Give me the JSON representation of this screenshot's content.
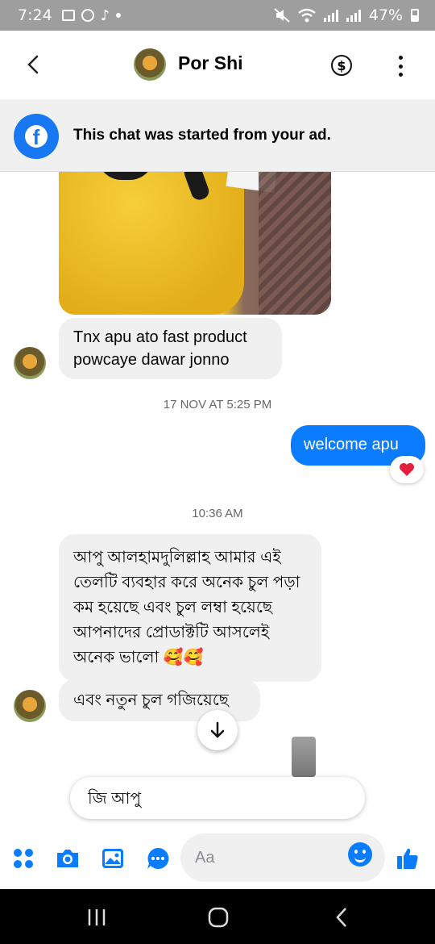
{
  "status_bar": {
    "time": "7:24",
    "battery": "47%"
  },
  "header": {
    "contact_name": "Por Shi"
  },
  "ad_banner": {
    "text": "This chat was started from your ad."
  },
  "messages": {
    "msg1": "Tnx apu ato fast product powcaye dawar jonno",
    "timestamp1": "17 NOV AT 5:25 PM",
    "msg2": "welcome apu",
    "timestamp2": "10:36 AM",
    "msg3": "আপু আলহামদুলিল্লাহ আমার এই তেলটি ব্যবহার করে অনেক চুল পড়া কম হয়েছে এবং চুল লম্বা হয়েছে আপনাদের প্রোডাক্টটি আসলেই অনেক ভালো 🥰🥰",
    "msg4": "এবং নতুন চুল গজিয়েছে"
  },
  "quick_reply": {
    "text": "জি আপু"
  },
  "composer": {
    "placeholder": "Aa"
  },
  "colors": {
    "accent": "#0a7cff",
    "facebook": "#1877f2",
    "bubble_in": "#f0f0f0",
    "reaction_heart": "#e41e3f"
  },
  "icons": [
    "back-icon",
    "dollar-icon",
    "more-icon",
    "facebook-icon",
    "heart-icon",
    "arrow-down-icon",
    "apps-icon",
    "camera-icon",
    "gallery-icon",
    "chat-icon",
    "emoji-icon",
    "like-icon",
    "recents-icon",
    "home-icon",
    "nav-back-icon"
  ]
}
